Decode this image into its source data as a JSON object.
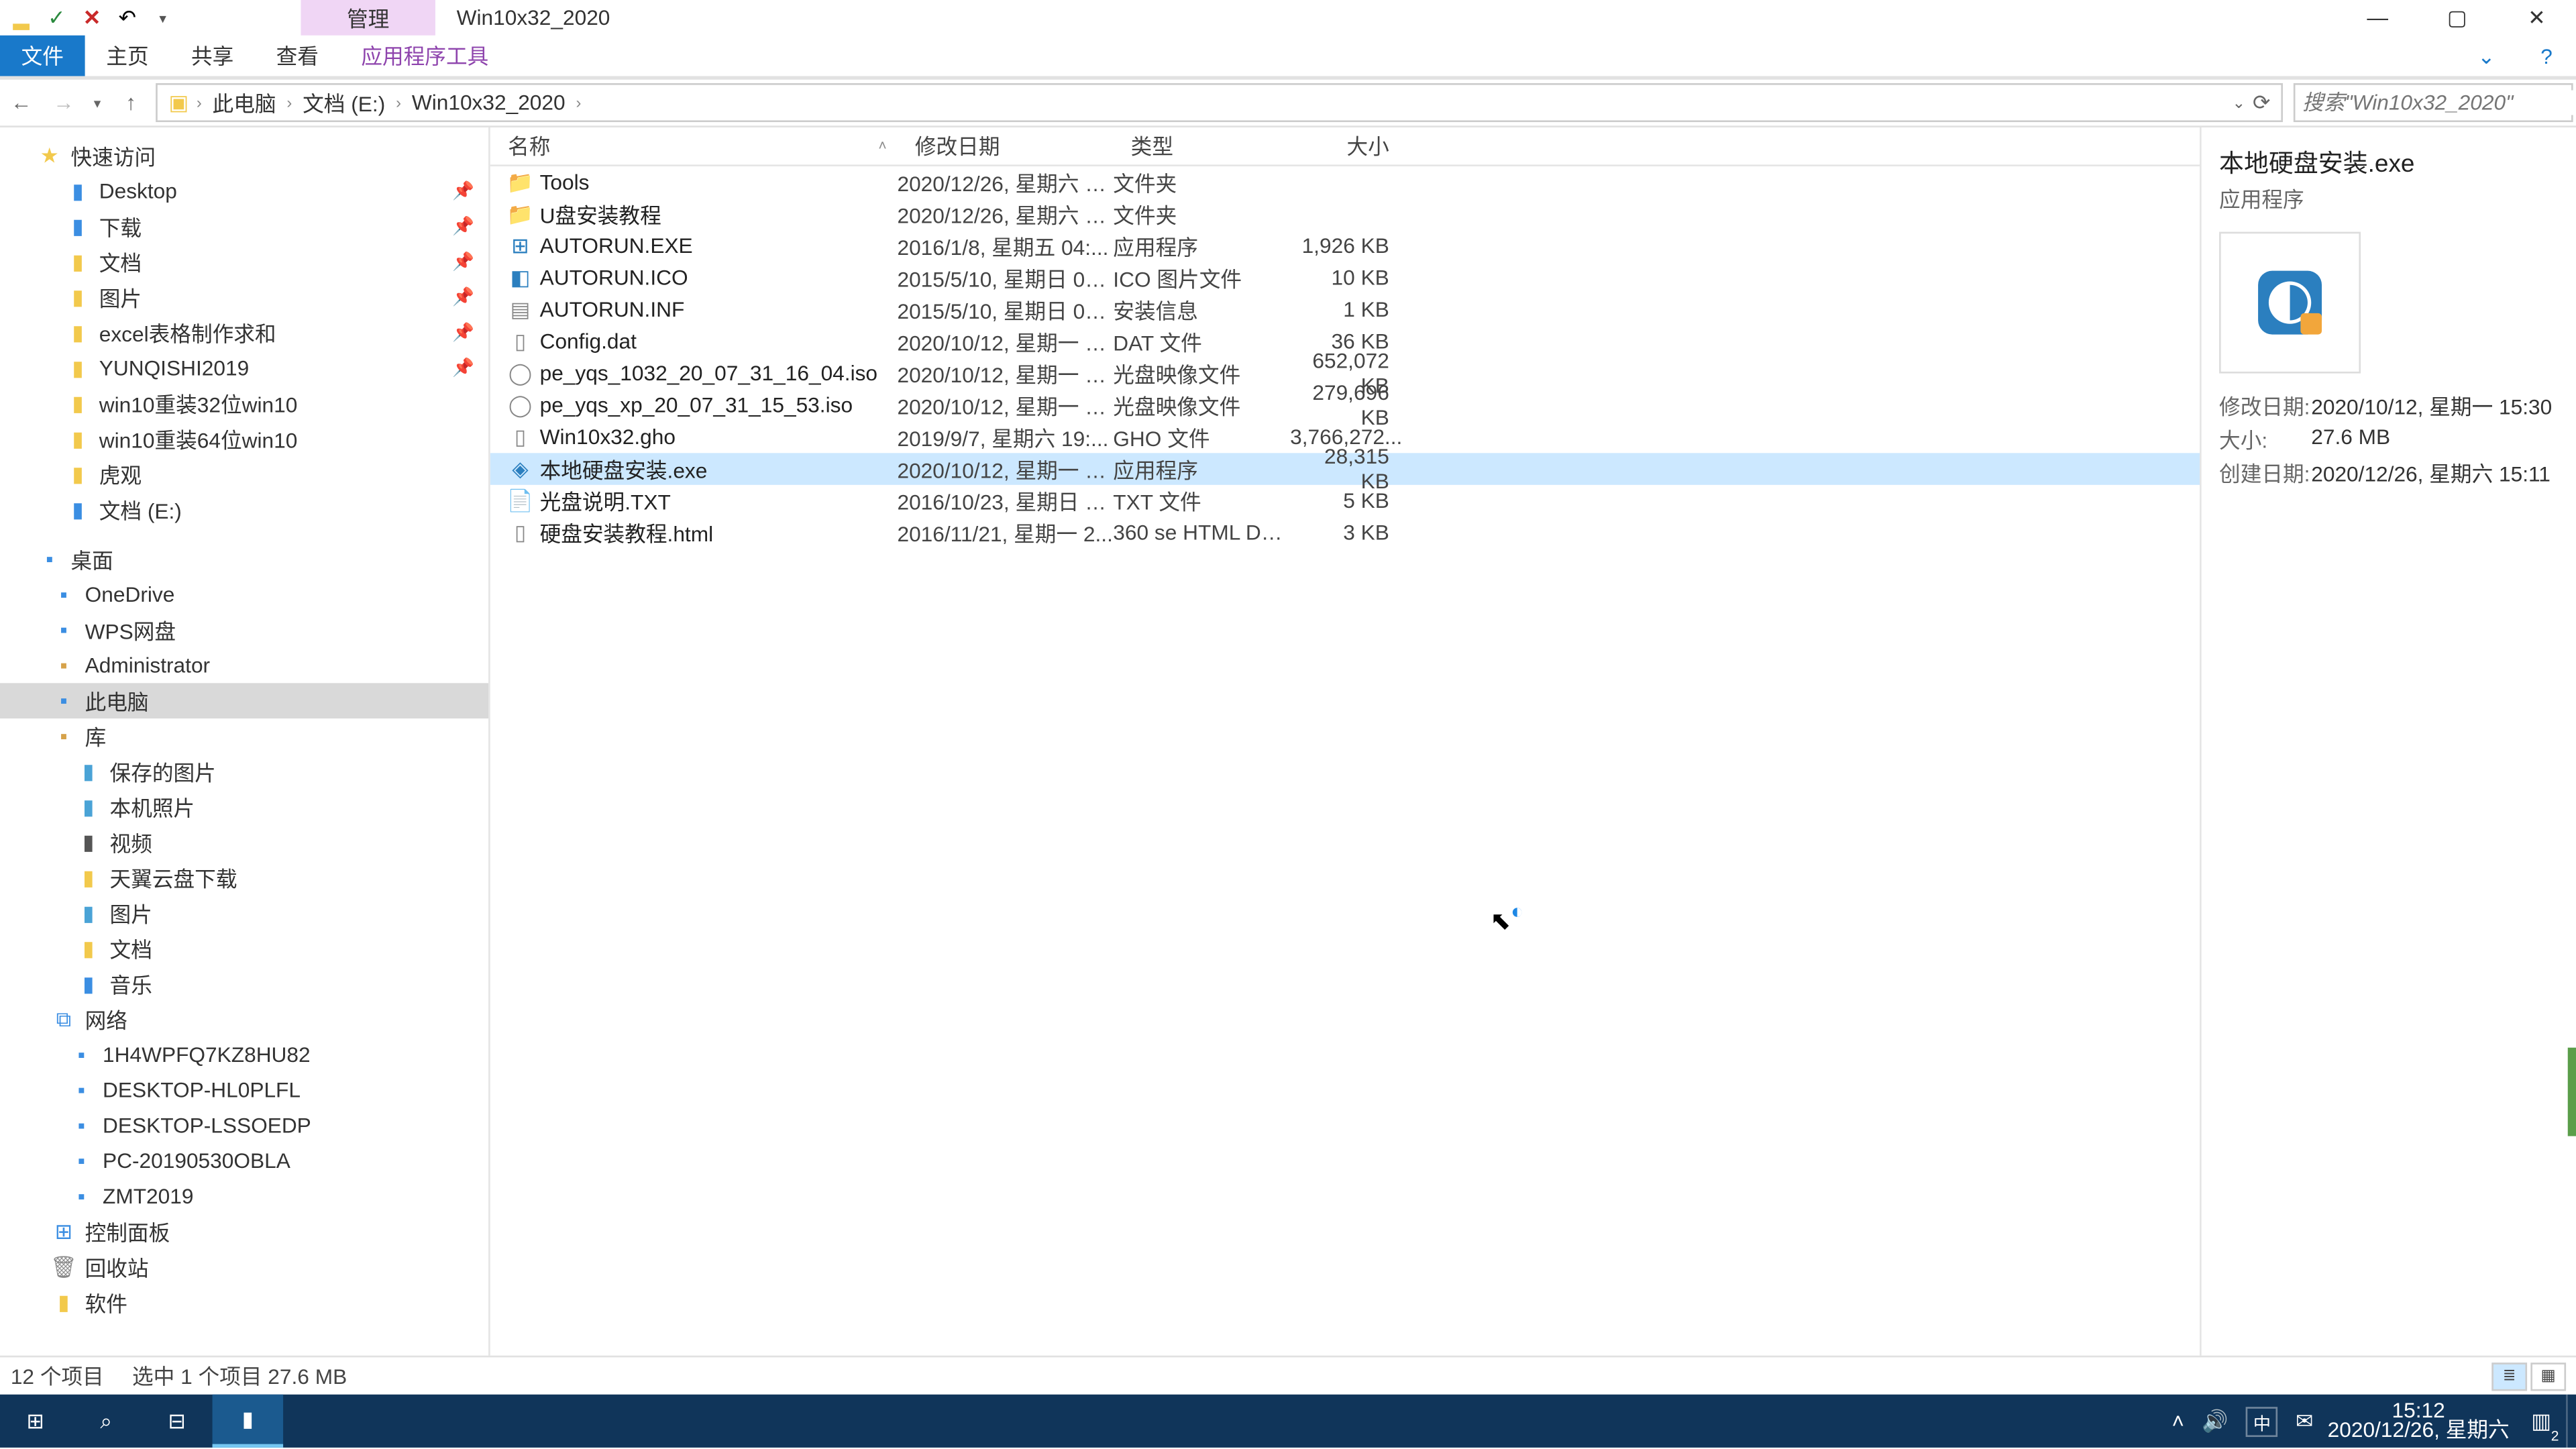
{
  "window": {
    "ctx_tab": "管理",
    "title": "Win10x32_2020"
  },
  "ribbon": {
    "file": "文件",
    "home": "主页",
    "share": "共享",
    "view": "查看",
    "tools": "应用程序工具"
  },
  "breadcrumb": {
    "items": [
      "此电脑",
      "文档 (E:)",
      "Win10x32_2020"
    ]
  },
  "search": {
    "placeholder": "搜索\"Win10x32_2020\""
  },
  "tree": {
    "quick": "快速访问",
    "q_items": [
      {
        "label": "Desktop",
        "icon": "ic-blue",
        "pin": true
      },
      {
        "label": "下载",
        "icon": "ic-blue",
        "pin": true
      },
      {
        "label": "文档",
        "icon": "ic-fld",
        "pin": true
      },
      {
        "label": "图片",
        "icon": "ic-fld",
        "pin": true
      },
      {
        "label": "excel表格制作求和",
        "icon": "ic-fld",
        "pin": true
      },
      {
        "label": "YUNQISHI2019",
        "icon": "ic-fld",
        "pin": true
      },
      {
        "label": "win10重装32位win10",
        "icon": "ic-fld",
        "pin": false
      },
      {
        "label": "win10重装64位win10",
        "icon": "ic-fld",
        "pin": false
      },
      {
        "label": "虎观",
        "icon": "ic-fld",
        "pin": false
      },
      {
        "label": "文档 (E:)",
        "icon": "ic-blue",
        "pin": false
      }
    ],
    "desktop": "桌面",
    "d_items": [
      {
        "label": "OneDrive",
        "icon": "ic-cloud"
      },
      {
        "label": "WPS网盘",
        "icon": "ic-wps"
      },
      {
        "label": "Administrator",
        "icon": "ic-user"
      },
      {
        "label": "此电脑",
        "icon": "ic-mon",
        "sel": true
      },
      {
        "label": "库",
        "icon": "ic-lib"
      }
    ],
    "lib_items": [
      {
        "label": "保存的图片",
        "icon": "ic-img"
      },
      {
        "label": "本机照片",
        "icon": "ic-img"
      },
      {
        "label": "视频",
        "icon": "ic-vid"
      },
      {
        "label": "天翼云盘下载",
        "icon": "ic-fld"
      },
      {
        "label": "图片",
        "icon": "ic-img"
      },
      {
        "label": "文档",
        "icon": "ic-fld"
      },
      {
        "label": "音乐",
        "icon": "ic-mus"
      }
    ],
    "network": "网络",
    "n_items": [
      {
        "label": "1H4WPFQ7KZ8HU82",
        "icon": "ic-pc"
      },
      {
        "label": "DESKTOP-HL0PLFL",
        "icon": "ic-pc"
      },
      {
        "label": "DESKTOP-LSSOEDP",
        "icon": "ic-pc"
      },
      {
        "label": "PC-20190530OBLA",
        "icon": "ic-pc"
      },
      {
        "label": "ZMT2019",
        "icon": "ic-pc"
      }
    ],
    "cp": "控制面板",
    "bin": "回收站",
    "soft": "软件"
  },
  "columns": {
    "name": "名称",
    "date": "修改日期",
    "type": "类型",
    "size": "大小"
  },
  "files": [
    {
      "icon": "fic-folder",
      "glyph": "📁",
      "name": "Tools",
      "date": "2020/12/26, 星期六 1...",
      "type": "文件夹",
      "size": ""
    },
    {
      "icon": "fic-folder",
      "glyph": "📁",
      "name": "U盘安装教程",
      "date": "2020/12/26, 星期六 1...",
      "type": "文件夹",
      "size": ""
    },
    {
      "icon": "fic-exe",
      "glyph": "⊞",
      "name": "AUTORUN.EXE",
      "date": "2016/1/8, 星期五 04:...",
      "type": "应用程序",
      "size": "1,926 KB"
    },
    {
      "icon": "fic-ico",
      "glyph": "◧",
      "name": "AUTORUN.ICO",
      "date": "2015/5/10, 星期日 02...",
      "type": "ICO 图片文件",
      "size": "10 KB"
    },
    {
      "icon": "fic-inf",
      "glyph": "▤",
      "name": "AUTORUN.INF",
      "date": "2015/5/10, 星期日 02...",
      "type": "安装信息",
      "size": "1 KB"
    },
    {
      "icon": "fic-dat",
      "glyph": "▯",
      "name": "Config.dat",
      "date": "2020/10/12, 星期一 1...",
      "type": "DAT 文件",
      "size": "36 KB"
    },
    {
      "icon": "fic-iso",
      "glyph": "◯",
      "name": "pe_yqs_1032_20_07_31_16_04.iso",
      "date": "2020/10/12, 星期一 1...",
      "type": "光盘映像文件",
      "size": "652,072 KB"
    },
    {
      "icon": "fic-iso",
      "glyph": "◯",
      "name": "pe_yqs_xp_20_07_31_15_53.iso",
      "date": "2020/10/12, 星期一 1...",
      "type": "光盘映像文件",
      "size": "279,696 KB"
    },
    {
      "icon": "fic-gho",
      "glyph": "▯",
      "name": "Win10x32.gho",
      "date": "2019/9/7, 星期六 19:...",
      "type": "GHO 文件",
      "size": "3,766,272..."
    },
    {
      "icon": "fic-app",
      "glyph": "◈",
      "name": "本地硬盘安装.exe",
      "date": "2020/10/12, 星期一 1...",
      "type": "应用程序",
      "size": "28,315 KB",
      "sel": true
    },
    {
      "icon": "fic-txt",
      "glyph": "📄",
      "name": "光盘说明.TXT",
      "date": "2016/10/23, 星期日 0...",
      "type": "TXT 文件",
      "size": "5 KB"
    },
    {
      "icon": "fic-html",
      "glyph": "▯",
      "name": "硬盘安装教程.html",
      "date": "2016/11/21, 星期一 2...",
      "type": "360 se HTML Do...",
      "size": "3 KB"
    }
  ],
  "preview": {
    "title": "本地硬盘安装.exe",
    "type": "应用程序",
    "modl": "修改日期:",
    "modv": "2020/10/12, 星期一 15:30",
    "sizel": "大小:",
    "sizev": "27.6 MB",
    "createl": "创建日期:",
    "createv": "2020/12/26, 星期六 15:11"
  },
  "status": {
    "count": "12 个项目",
    "sel": "选中 1 个项目  27.6 MB"
  },
  "taskbar": {
    "ime": "中",
    "time": "15:12",
    "date": "2020/12/26, 星期六",
    "badge": "2"
  }
}
